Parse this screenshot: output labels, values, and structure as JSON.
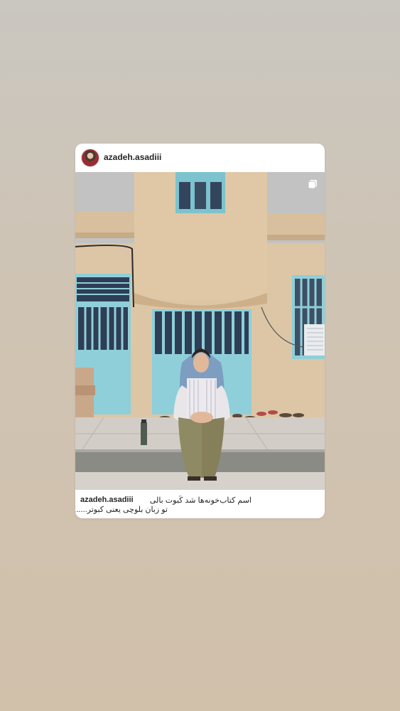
{
  "post": {
    "username": "azadeh.asadiii",
    "caption_username": "azadeh.asadiii",
    "caption_line1": "اسم کتاب‌خونه‌ها شد کَبوت بالی",
    "caption_line2": "تو زبان بلوچی یعنی کبوتر......"
  },
  "icons": {
    "avatar": "profile-avatar",
    "multi_post": "carousel-icon"
  },
  "colors": {
    "background": "#cfc4b4",
    "card": "#ffffff",
    "door": "#8fcfd9",
    "wall": "#dcc4a4"
  }
}
